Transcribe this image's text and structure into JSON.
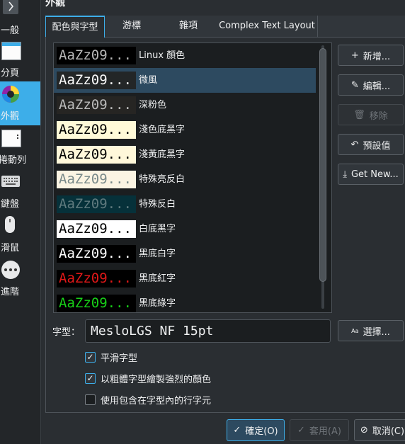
{
  "window_title": "外觀",
  "sidebar": {
    "items": [
      {
        "label": "一般",
        "icon": "chevron-right-icon"
      },
      {
        "label": "分頁",
        "icon": "window-tabs-icon"
      },
      {
        "label": "外觀",
        "icon": "color-wheel-icon"
      },
      {
        "label": "捲動列",
        "icon": "scrollbar-icon"
      },
      {
        "label": "鍵盤",
        "icon": "keyboard-icon"
      },
      {
        "label": "滑鼠",
        "icon": "mouse-icon"
      },
      {
        "label": "進階",
        "icon": "more-icon"
      }
    ]
  },
  "tabs": [
    "配色與字型",
    "游標",
    "雜項",
    "Complex Text Layout"
  ],
  "schemes": [
    {
      "sample": "AaZz09...",
      "name": "Linux 顏色",
      "fg": "#b8b8b8",
      "bg": "#000000"
    },
    {
      "sample": "AaZz09...",
      "name": "微風",
      "fg": "#fcfcfc",
      "bg": "#232627"
    },
    {
      "sample": "AaZz09...",
      "name": "深粉色",
      "fg": "#bababa",
      "bg": "#262523"
    },
    {
      "sample": "AaZz09...",
      "name": "淺色底黑字",
      "fg": "#000000",
      "bg": "#fffad8"
    },
    {
      "sample": "AaZz09...",
      "name": "淺黃底黑字",
      "fg": "#000000",
      "bg": "#fff8da"
    },
    {
      "sample": "AaZz09...",
      "name": "特殊亮反白",
      "fg": "#7a8a8a",
      "bg": "#fbf4e3"
    },
    {
      "sample": "AaZz09...",
      "name": "特殊反白",
      "fg": "#5f7a7e",
      "bg": "#06313a"
    },
    {
      "sample": "AaZz09...",
      "name": "白底黑字",
      "fg": "#000000",
      "bg": "#ffffff"
    },
    {
      "sample": "AaZz09...",
      "name": "黑底白字",
      "fg": "#ffffff",
      "bg": "#000000"
    },
    {
      "sample": "AaZz09...",
      "name": "黑底紅字",
      "fg": "#e01818",
      "bg": "#000000"
    },
    {
      "sample": "AaZz09...",
      "name": "黑底綠字",
      "fg": "#18d018",
      "bg": "#000000"
    }
  ],
  "selected_scheme_index": 1,
  "buttons": {
    "new": "新增...",
    "edit": "編輯...",
    "remove": "移除",
    "defaults": "預設值",
    "get_new": "Get New..."
  },
  "font": {
    "label": "字型：",
    "value": "MesloLGS NF 15pt",
    "select_prefix": "Aa",
    "select": "選擇..."
  },
  "options": [
    {
      "label": "平滑字型",
      "checked": true
    },
    {
      "label": "以粗體字型繪製強烈的顏色",
      "checked": true
    },
    {
      "label": "使用包含在字型內的行字元",
      "checked": false
    }
  ],
  "footer": {
    "ok": "確定(O)",
    "apply": "套用(A)",
    "cancel": "取消(C)"
  },
  "colors": {
    "accent": "#3daee9",
    "selection": "#2d4a60",
    "window_bg": "#2a2e32",
    "view_bg": "#1b1e20"
  }
}
